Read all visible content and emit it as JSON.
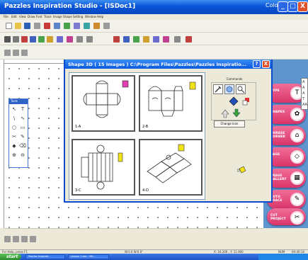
{
  "window": {
    "title": "Pazzles Inspiration Studio - [ISDoc1]",
    "color_label": "Color",
    "min_glyph": "_",
    "max_glyph": "□",
    "close_glyph": "X"
  },
  "menu": [
    "File",
    "Edit",
    "View",
    "Draw",
    "Font",
    "Trace",
    "Image",
    "Shape",
    "Setting",
    "Window",
    "Help"
  ],
  "tool_palette": {
    "title": "Tools",
    "tools": [
      "↖",
      "T",
      "\\",
      "∿",
      "○",
      "▭",
      "✂",
      "✎",
      "◆",
      "⌫",
      "⊕",
      "⊖"
    ]
  },
  "dialog": {
    "title": "Shape 3D ( 15 Images )   C:\\Program Files\\Pazzles\\Pazzles Inspiratio...",
    "help_glyph": "?",
    "close_glyph": "X",
    "shapes": [
      {
        "label": "1-A"
      },
      {
        "label": "2-B"
      },
      {
        "label": "3-C"
      },
      {
        "label": "4-D"
      }
    ],
    "commands_label": "Commands",
    "change_icon_label": "Change Icon"
  },
  "right_panel": {
    "buttons": [
      {
        "label": "TYPE",
        "icon": "T"
      },
      {
        "label": "SHAPES",
        "icon": "✿"
      },
      {
        "label": "PHRASE CORNER",
        "icon": "⌂"
      },
      {
        "label": "TAGS",
        "icon": "◇"
      },
      {
        "label": "IMAGE GALLERY",
        "icon": "▦"
      },
      {
        "label": "AUTO TRACE",
        "icon": "✎"
      },
      {
        "label": "CUT PROJECT",
        "icon": "✂"
      }
    ],
    "edge_glyphs": [
      "A",
      "A",
      "A",
      "T",
      "AA"
    ]
  },
  "status": {
    "help_text": "For Help, press F1",
    "wh": "W:0.0  W:0.0\"",
    "coords": "X: 16.200 , Y: 11.900",
    "num": "NUM",
    "time": "04:40:14"
  },
  "taskbar": {
    "start": "start",
    "tasks": [
      "Pazzles Inspirati...",
      "Lesson 1.doc - Mic..."
    ]
  },
  "colors": {
    "accent": "#0a55d8",
    "side_button": "#d93469",
    "panel": "#5f95cf"
  }
}
